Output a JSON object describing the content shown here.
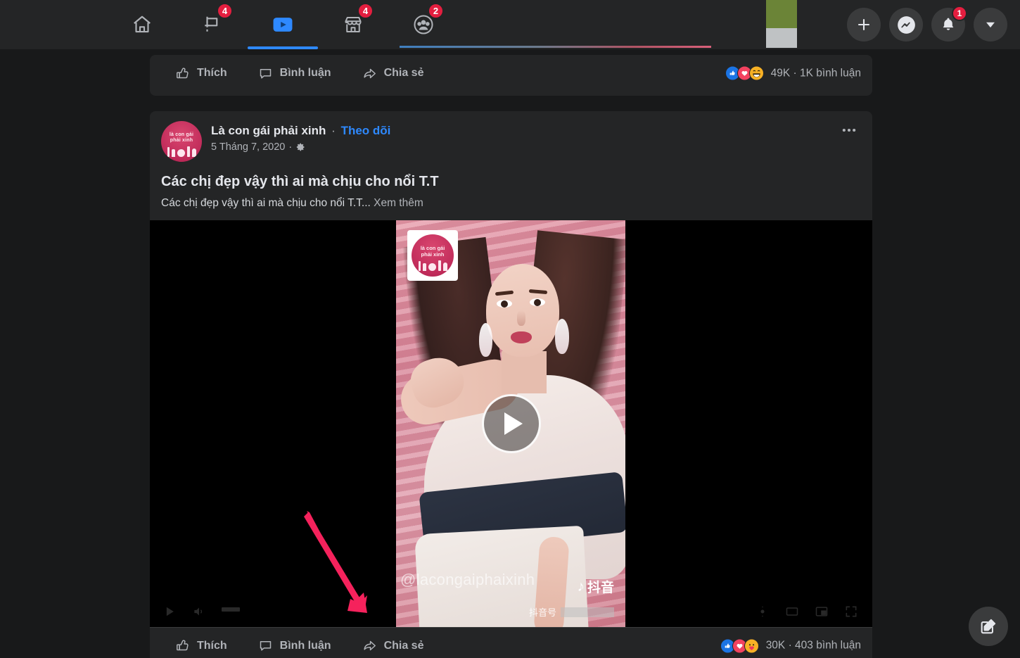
{
  "nav": {
    "tabs": [
      {
        "name": "home",
        "icon": "home-icon",
        "badge": "",
        "active": false
      },
      {
        "name": "pages",
        "icon": "flag-icon",
        "badge": "4",
        "active": false
      },
      {
        "name": "watch",
        "icon": "video-play-icon",
        "badge": "",
        "active": true
      },
      {
        "name": "marketplace",
        "icon": "storefront-icon",
        "badge": "4",
        "active": false
      },
      {
        "name": "groups",
        "icon": "groups-icon",
        "badge": "2",
        "active": false
      }
    ],
    "right_buttons": [
      {
        "name": "create",
        "icon": "plus-icon",
        "badge": ""
      },
      {
        "name": "messenger",
        "icon": "messenger-icon",
        "badge": ""
      },
      {
        "name": "notifications",
        "icon": "bell-icon",
        "badge": "1"
      },
      {
        "name": "account",
        "icon": "chevron-down-icon",
        "badge": ""
      }
    ],
    "accent_blue": "#2e89ff",
    "badge_red": "#e41e3f"
  },
  "top_post": {
    "actions": [
      {
        "label": "Thích",
        "icon": "thumbs-up-icon"
      },
      {
        "label": "Bình luận",
        "icon": "comment-icon"
      },
      {
        "label": "Chia sẻ",
        "icon": "share-icon"
      }
    ],
    "reactions": [
      "like",
      "love",
      "haha"
    ],
    "counts_text": "49K · 1K bình luận"
  },
  "post": {
    "avatar_text_line1": "là con gái",
    "avatar_text_line2": "phải xinh",
    "page_name": "Là con gái phải xinh",
    "separator": "·",
    "follow_label": "Theo dõi",
    "date": "5 Tháng 7, 2020",
    "privacy_icon": "gear-icon",
    "title": "Các chị đẹp vậy thì ai mà chịu cho nổi T.T",
    "body": "Các chị đẹp vậy thì ai mà chịu cho nổi T.T...",
    "see_more": "Xem thêm",
    "menu_icon": "ellipsis-icon",
    "actions": [
      {
        "label": "Thích",
        "icon": "thumbs-up-icon"
      },
      {
        "label": "Bình luận",
        "icon": "comment-icon"
      },
      {
        "label": "Chia sẻ",
        "icon": "share-icon"
      }
    ],
    "reactions": [
      "like",
      "love",
      "care"
    ],
    "counts_text": "30K · 403 bình luận"
  },
  "video": {
    "play_icon": "play-icon",
    "watermark": "@lacongaiphaixinh",
    "douyin_label": "抖音",
    "douyin_id_label": "抖音号",
    "logo_line1": "là con gái",
    "logo_line2": "phải xinh",
    "controls_left": [
      "play-icon",
      "volume-icon",
      "time-display"
    ],
    "controls_right": [
      "settings-icon",
      "theater-mode-icon",
      "pip-icon",
      "fullscreen-icon"
    ]
  },
  "annotation": {
    "type": "arrow",
    "color": "#F5225C",
    "points_to": "Chia sẻ"
  },
  "fab": {
    "name": "compose-button",
    "icon": "pencil-square-icon"
  },
  "theme": {
    "page_bg": "#18191a",
    "card_bg": "#242526",
    "text_primary": "#e4e6eb",
    "text_secondary": "#b0b3b8",
    "hover": "#3a3b3c"
  }
}
